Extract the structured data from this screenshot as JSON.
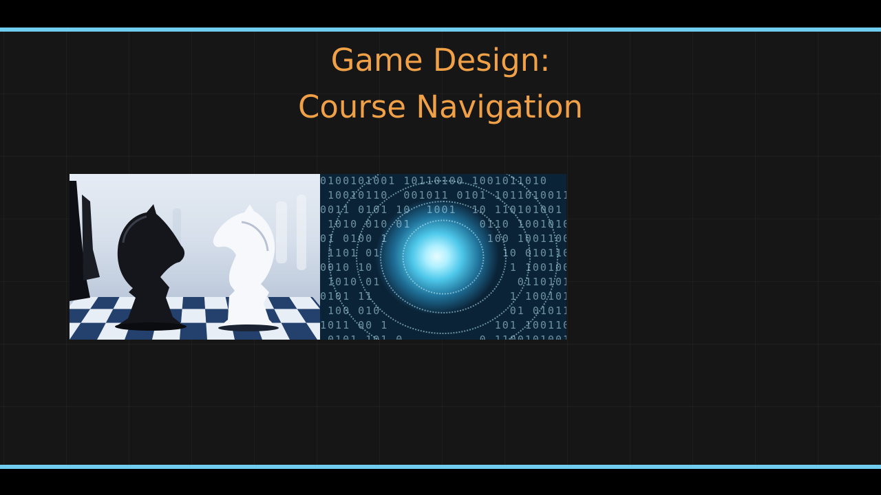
{
  "slide": {
    "title_line1": "Game Design:",
    "title_line2": "Course Navigation"
  },
  "images": {
    "left": "chess-knights-image",
    "right": "binary-tunnel-image"
  },
  "colors": {
    "accent_rule": "#6fcdf0",
    "title": "#f0a046",
    "background": "#161616"
  }
}
